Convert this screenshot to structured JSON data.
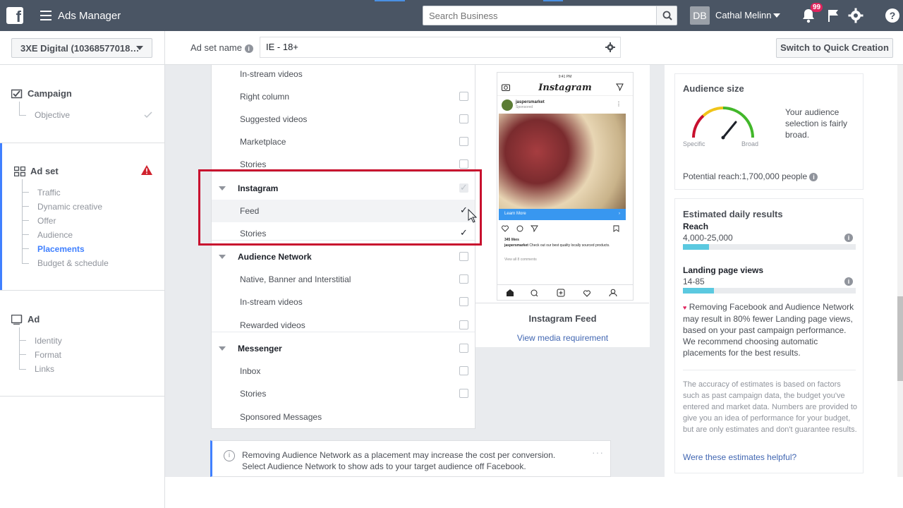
{
  "topbar": {
    "logo": "f",
    "title": "Ads Manager",
    "search_placeholder": "Search Business",
    "user_initials": "DB",
    "user_name": "Cathal Melinn",
    "notification_count": "99"
  },
  "subbar": {
    "account": "3XE Digital (10368577018…",
    "adset_label": "Ad set name",
    "adset_value": "IE - 18+",
    "quick_creation": "Switch to Quick Creation"
  },
  "sidebar": {
    "campaign": {
      "title": "Campaign",
      "items": [
        "Objective"
      ]
    },
    "adset": {
      "title": "Ad set",
      "items": [
        "Traffic",
        "Dynamic creative",
        "Offer",
        "Audience",
        "Placements",
        "Budget & schedule"
      ],
      "active": "Placements"
    },
    "ad": {
      "title": "Ad",
      "items": [
        "Identity",
        "Format",
        "Links"
      ]
    }
  },
  "placements": {
    "rows": [
      {
        "label": "In-stream videos",
        "checked": false
      },
      {
        "label": "Right column",
        "checked": false
      },
      {
        "label": "Suggested videos",
        "checked": false
      },
      {
        "label": "Marketplace",
        "checked": false
      },
      {
        "label": "Stories",
        "checked": false
      },
      {
        "label": "Instagram",
        "group": true,
        "checked": true
      },
      {
        "label": "Feed",
        "checked": true
      },
      {
        "label": "Stories",
        "checked": true
      },
      {
        "label": "Audience Network",
        "group": true,
        "checked": false
      },
      {
        "label": "Native, Banner and Interstitial",
        "checked": false
      },
      {
        "label": "In-stream videos",
        "checked": false
      },
      {
        "label": "Rewarded videos",
        "checked": false
      },
      {
        "label": "Messenger",
        "group": true,
        "checked": false
      },
      {
        "label": "Inbox",
        "checked": false
      },
      {
        "label": "Stories",
        "checked": false
      },
      {
        "label": "Sponsored Messages",
        "checked": false
      }
    ]
  },
  "preview": {
    "time": "9:41 PM",
    "app_name": "Instagram",
    "account": "jaspersmarket",
    "sponsored": "Sponsored",
    "cta": "Learn More",
    "likes": "345 likes",
    "caption_user": "jaspersmarket",
    "caption": "Check out our best quality locally sourced products.",
    "comments": "View all 8 comments",
    "title": "Instagram Feed",
    "link": "View media requirement"
  },
  "notice": {
    "text": "Removing Audience Network as a placement may increase the cost per conversion. Select Audience Network to show ads to your target audience off Facebook."
  },
  "audience": {
    "title": "Audience size",
    "specific": "Specific",
    "broad": "Broad",
    "description": "Your audience selection is fairly broad.",
    "potential_reach": "Potential reach:1,700,000 people"
  },
  "estimates": {
    "title": "Estimated daily results",
    "reach_label": "Reach",
    "reach_value": "4,000-25,000",
    "reach_fill": 0.15,
    "lpv_label": "Landing page views",
    "lpv_value": "14-85",
    "lpv_fill": 0.18,
    "warning": "Removing Facebook and Audience Network may result in 80% fewer Landing page views, based on your past campaign performance. We recommend choosing automatic placements for the best results.",
    "disclaimer": "The accuracy of estimates is based on factors such as past campaign data, the budget you've entered and market data. Numbers are provided to give you an idea of performance for your budget, but are only estimates and don't guarantee results.",
    "helpful": "Were these estimates helpful?"
  },
  "colors": {
    "topbar": "#4a5564",
    "link": "#4267b2",
    "active": "#4080ff",
    "highlight_box": "#c8102e",
    "metric_bar": "#5bc9e0"
  }
}
